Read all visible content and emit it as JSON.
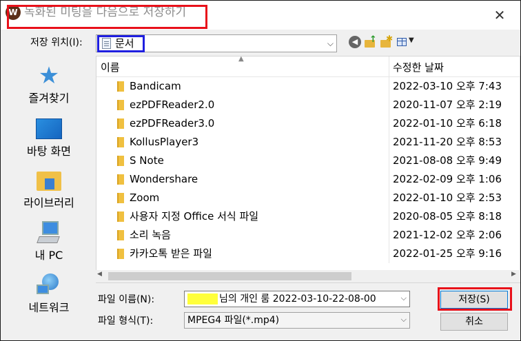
{
  "window": {
    "title": "녹화된 미팅을 다음으로 저장하기",
    "app_icon_glyph": "W",
    "close_glyph": "✕"
  },
  "location": {
    "label": "저장 위치(I):",
    "value": "문서"
  },
  "sidebar": {
    "items": [
      {
        "label": "즐겨찾기",
        "icon": "star-icon"
      },
      {
        "label": "바탕 화면",
        "icon": "desktop-icon"
      },
      {
        "label": "라이브러리",
        "icon": "library-icon"
      },
      {
        "label": "내 PC",
        "icon": "computer-icon"
      },
      {
        "label": "네트워크",
        "icon": "network-icon"
      }
    ]
  },
  "file_list": {
    "columns": [
      "이름",
      "수정한 날짜"
    ],
    "rows": [
      {
        "name": "Bandicam",
        "date": "2022-03-10 오후 7:43"
      },
      {
        "name": "ezPDFReader2.0",
        "date": "2020-11-07 오후 2:19"
      },
      {
        "name": "ezPDFReader3.0",
        "date": "2022-01-10 오후 6:18"
      },
      {
        "name": "KollusPlayer3",
        "date": "2021-11-20 오후 8:53"
      },
      {
        "name": "S Note",
        "date": "2021-08-08 오후 9:49"
      },
      {
        "name": "Wondershare",
        "date": "2022-02-09 오후 1:06"
      },
      {
        "name": "Zoom",
        "date": "2022-01-10 오후 2:53"
      },
      {
        "name": "사용자 지정 Office 서식 파일",
        "date": "2020-08-05 오후 8:18"
      },
      {
        "name": "소리 녹음",
        "date": "2021-12-02 오후 2:06"
      },
      {
        "name": "카카오톡 받은 파일",
        "date": "2022-01-25 오후 9:16"
      }
    ]
  },
  "filename": {
    "label": "파일 이름(N):",
    "value": "님의 개인 룸 2022-03-10-22-08-00"
  },
  "filetype": {
    "label": "파일 형식(T):",
    "value": "MPEG4 파일(*.mp4)"
  },
  "buttons": {
    "save": "저장(S)",
    "cancel": "취소"
  },
  "colors": {
    "highlight_red": "#e8101a",
    "highlight_blue": "#1f1fe0",
    "redaction_yellow": "#ffff3a"
  }
}
